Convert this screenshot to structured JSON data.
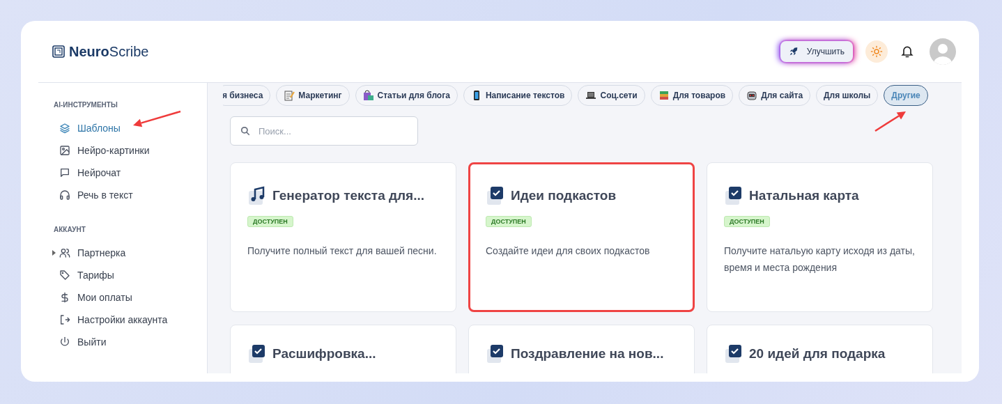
{
  "logo": {
    "brand_bold": "Neuro",
    "brand_light": "Scribe"
  },
  "header": {
    "upgrade_button": "Улучшить"
  },
  "sidebar": {
    "sections": [
      {
        "title": "AI-ИНСТРУМЕНТЫ",
        "items": [
          {
            "label": "Шаблоны",
            "kind": "layers",
            "selected": true,
            "annotated": true,
            "expandable": false
          },
          {
            "label": "Нейро-картинки",
            "kind": "image",
            "selected": false,
            "expandable": false
          },
          {
            "label": "Нейрочат",
            "kind": "chat",
            "selected": false,
            "expandable": false
          },
          {
            "label": "Речь в текст",
            "kind": "headphones",
            "selected": false,
            "expandable": false
          }
        ]
      },
      {
        "title": "АККАУНТ",
        "items": [
          {
            "label": "Партнерка",
            "kind": "users",
            "selected": false,
            "expandable": true
          },
          {
            "label": "Тарифы",
            "kind": "tag",
            "selected": false,
            "expandable": false
          },
          {
            "label": "Мои оплаты",
            "kind": "dollar",
            "selected": false,
            "expandable": false
          },
          {
            "label": "Настройки аккаунта",
            "kind": "logout",
            "selected": false,
            "expandable": false
          },
          {
            "label": "Выйти",
            "kind": "power",
            "selected": false,
            "expandable": false
          }
        ]
      }
    ]
  },
  "categories": [
    {
      "label": "я бизнеса",
      "kind": "none",
      "selected": false
    },
    {
      "label": "Маркетинг",
      "kind": "memo",
      "selected": false
    },
    {
      "label": "Статьи для блога",
      "kind": "bag",
      "selected": false
    },
    {
      "label": "Написание текстов",
      "kind": "phone",
      "selected": false
    },
    {
      "label": "Соц.сети",
      "kind": "laptop",
      "selected": false
    },
    {
      "label": "Для товаров",
      "kind": "books",
      "selected": false
    },
    {
      "label": "Для сайта",
      "kind": "robot",
      "selected": false
    },
    {
      "label": "Для школы",
      "kind": "none",
      "selected": false
    },
    {
      "label": "Другие",
      "kind": "none",
      "selected": true,
      "annotated": true
    }
  ],
  "search": {
    "placeholder": "Поиск..."
  },
  "cards": [
    {
      "title": "Генератор текста для...",
      "kind": "music",
      "badge": "ДОСТУПЕН",
      "description": "Получите полный текст для вашей песни.",
      "highlighted": false
    },
    {
      "title": "Идеи подкастов",
      "kind": "check",
      "badge": "ДОСТУПЕН",
      "description": "Создайте идеи для своих подкастов",
      "highlighted": true
    },
    {
      "title": "Натальная карта",
      "kind": "check",
      "badge": "ДОСТУПЕН",
      "description": "Получите натальую карту исходя из даты, время и места рождения",
      "highlighted": false
    },
    {
      "title": "Расшифровка...",
      "kind": "check",
      "highlighted": false
    },
    {
      "title": "Поздравление на нов...",
      "kind": "check",
      "highlighted": false
    },
    {
      "title": "20 идей для подарка",
      "kind": "check",
      "highlighted": false
    }
  ]
}
